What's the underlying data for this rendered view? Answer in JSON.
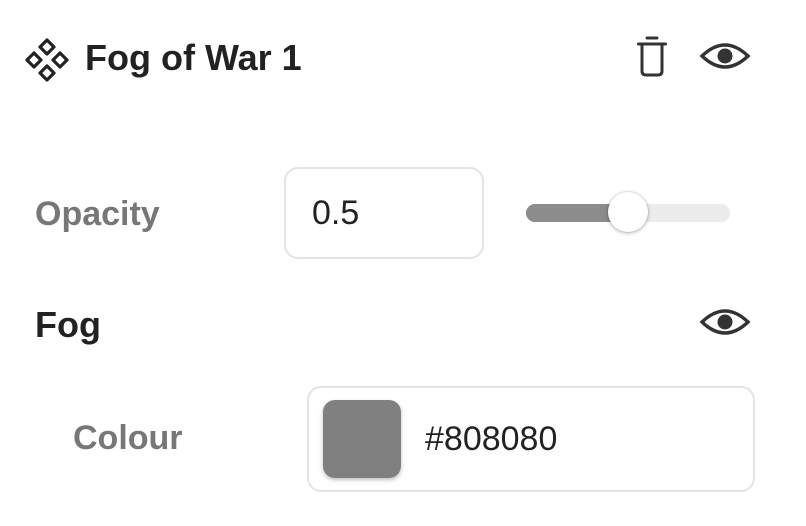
{
  "layer": {
    "title": "Fog of War 1",
    "icon": "component-icon",
    "actions": [
      {
        "name": "delete",
        "icon": "trash-icon"
      },
      {
        "name": "toggle-visibility",
        "icon": "eye-icon"
      }
    ]
  },
  "opacity": {
    "label": "Opacity",
    "value": "0.5",
    "slider_fraction": 0.5
  },
  "fog": {
    "label": "Fog",
    "visibility_icon": "eye-icon",
    "colour": {
      "label": "Colour",
      "hex": "#808080",
      "swatch_color": "#808080"
    }
  },
  "colors": {
    "slider_fill": "#8c8c8c",
    "slider_track": "#ececec",
    "muted_label": "#777777",
    "text": "#222222"
  }
}
